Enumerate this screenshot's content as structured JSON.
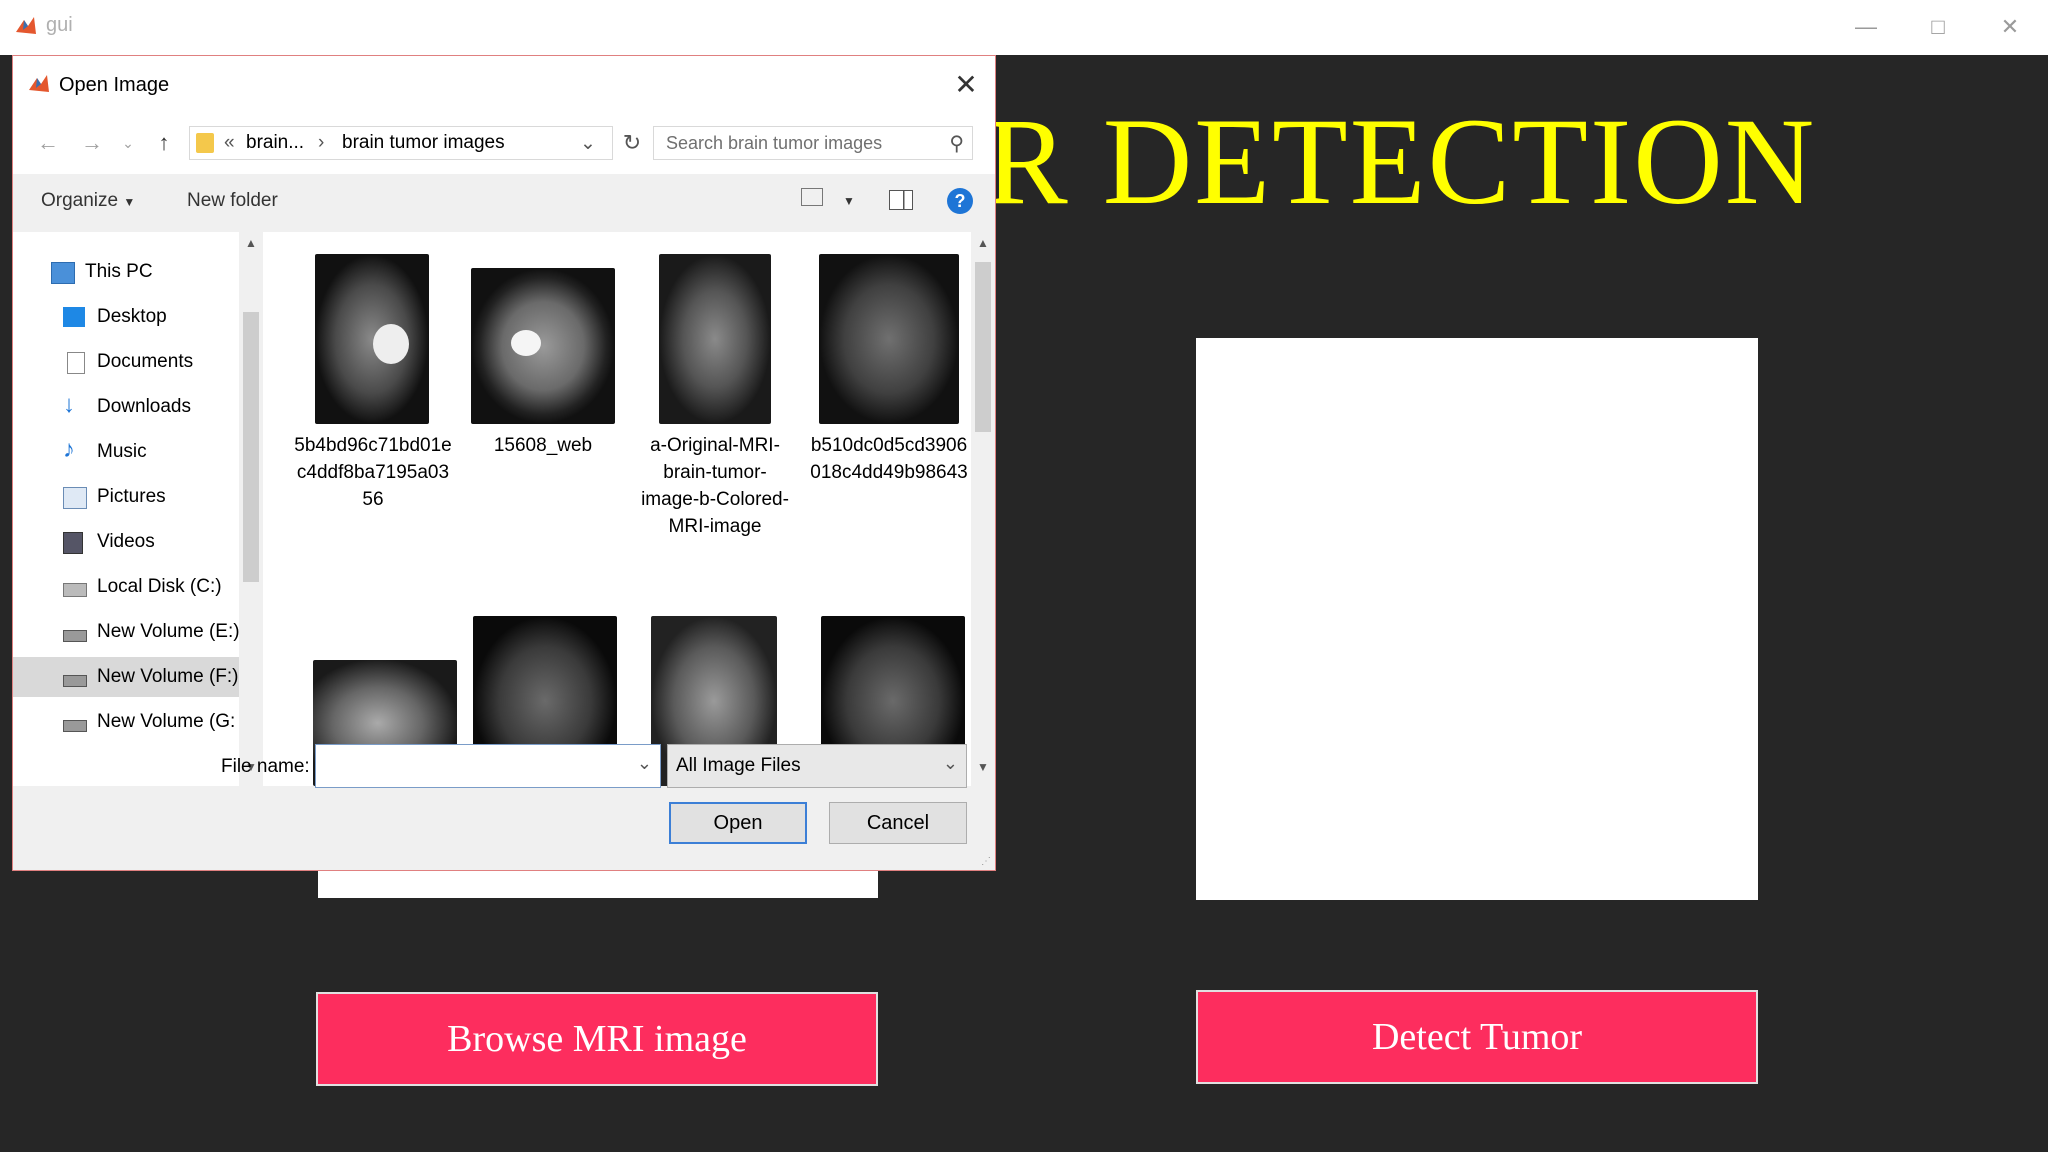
{
  "app": {
    "title": "gui",
    "icon": "matlab-icon"
  },
  "headline": "R DETECTION",
  "buttons": {
    "browse": "Browse MRI image",
    "detect": "Detect Tumor"
  },
  "dialog": {
    "title": "Open Image",
    "breadcrumb": {
      "prefix": "«",
      "parent": "brain...",
      "current": "brain tumor images"
    },
    "search_placeholder": "Search brain tumor images",
    "toolbar": {
      "organize": "Organize",
      "new_folder": "New folder"
    },
    "nav_items": [
      {
        "label": "This PC",
        "icon": "computer-icon"
      },
      {
        "label": "Desktop",
        "icon": "desktop-icon"
      },
      {
        "label": "Documents",
        "icon": "documents-icon"
      },
      {
        "label": "Downloads",
        "icon": "downloads-icon"
      },
      {
        "label": "Music",
        "icon": "music-icon"
      },
      {
        "label": "Pictures",
        "icon": "pictures-icon"
      },
      {
        "label": "Videos",
        "icon": "videos-icon"
      },
      {
        "label": "Local Disk (C:)",
        "icon": "drive-icon"
      },
      {
        "label": "New Volume (E:)",
        "icon": "drive-icon"
      },
      {
        "label": "New Volume (F:)",
        "icon": "drive-icon",
        "selected": true
      },
      {
        "label": "New Volume (G:",
        "icon": "drive-icon"
      }
    ],
    "files": [
      {
        "name": "5b4bd96c71bd01ec4ddf8ba7195a0356"
      },
      {
        "name": "15608_web"
      },
      {
        "name": "a-Original-MRI-brain-tumor-image-b-Colored-MRI-image"
      },
      {
        "name": "b510dc0d5cd3906018c4dd49b98643"
      }
    ],
    "file_name_label": "File name:",
    "file_name_value": "",
    "filter": "All Image Files",
    "open": "Open",
    "cancel": "Cancel"
  },
  "colors": {
    "accent": "#fd2d5e",
    "headline": "#ffff00",
    "background": "#262626"
  }
}
